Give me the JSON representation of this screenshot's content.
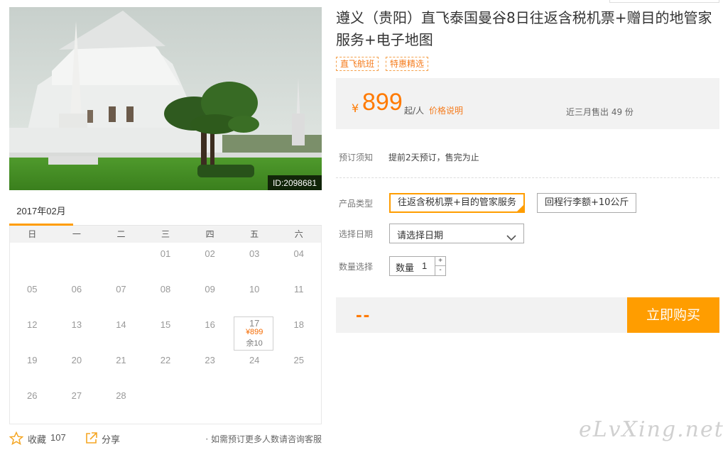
{
  "photo": {
    "id_label": "ID:2098681"
  },
  "calendar": {
    "month": "2017年02月",
    "weekdays": [
      "日",
      "一",
      "二",
      "三",
      "四",
      "五",
      "六"
    ],
    "rows": [
      [
        "",
        "",
        "",
        "01",
        "02",
        "03",
        "04"
      ],
      [
        "05",
        "06",
        "07",
        "08",
        "09",
        "10",
        "11"
      ],
      [
        "12",
        "13",
        "14",
        "15",
        "16",
        "17",
        "18"
      ],
      [
        "19",
        "20",
        "21",
        "22",
        "23",
        "24",
        "25"
      ],
      [
        "26",
        "27",
        "28",
        "",
        "",
        "",
        ""
      ]
    ],
    "available": {
      "date": "17",
      "price": "¥899",
      "remaining": "余10"
    }
  },
  "bottom": {
    "fav_label": "收藏",
    "fav_count": "107",
    "share_label": "分享",
    "note": "· 如需预订更多人数请咨询客服"
  },
  "product": {
    "title": "遵义（贵阳）直飞泰国曼谷8日往返含税机票+赠目的地管家服务+电子地图",
    "tags": [
      "直飞航班",
      "特惠精选"
    ]
  },
  "price": {
    "currency": "¥",
    "value": "899",
    "unit": "起/人",
    "explain": "价格说明",
    "sold": "近三月售出 49 份"
  },
  "notice": {
    "label": "预订须知",
    "value": "提前2天预订，售完为止"
  },
  "options": {
    "type_label": "产品类型",
    "types": [
      "往返含税机票+目的管家服务",
      "回程行李额+10公斤"
    ],
    "date_label": "选择日期",
    "date_placeholder": "请选择日期",
    "qty_label": "数量选择",
    "qty_text": "数量",
    "qty_value": "1",
    "qty_plus": "+",
    "qty_minus": "-"
  },
  "buy": {
    "total": "--",
    "button": "立即购买"
  },
  "watermark": "eLvXing.net",
  "colors": {
    "accent": "#ff9d00",
    "price": "#ff7a00",
    "panel": "#f2f2f2"
  }
}
